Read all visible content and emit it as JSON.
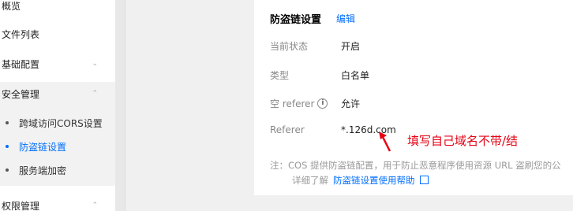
{
  "sidebar": {
    "items": [
      {
        "label": "概览",
        "chevron": ""
      },
      {
        "label": "文件列表",
        "chevron": ""
      },
      {
        "label": "基础配置",
        "chevron": "⌄"
      },
      {
        "label": "安全管理",
        "chevron": "⌃"
      }
    ],
    "security_sub": [
      {
        "label": "跨域访问CORS设置"
      },
      {
        "label": "防盗链设置"
      },
      {
        "label": "服务端加密"
      }
    ],
    "bottom_item": {
      "label": "权限管理",
      "chevron": "⌃"
    }
  },
  "card": {
    "title": "防盗链设置",
    "edit_label": "编辑",
    "rows": [
      {
        "key": "当前状态",
        "value": "开启"
      },
      {
        "key": "类型",
        "value": "白名单"
      },
      {
        "key": "空 referer",
        "value": "允许"
      },
      {
        "key": "Referer",
        "value": "*.126d.com"
      }
    ],
    "note_line1": "注：COS 提供防盗链配置，用于防止恶意程序使用资源 URL 盗刷您的公",
    "note_line2_prefix": "详细了解",
    "note_link": "防盗链设置使用帮助"
  },
  "annotation": {
    "text": "填写自己域名不带/结",
    "color": "#e60012"
  },
  "colors": {
    "accent": "#006eff",
    "annotation": "#e60012"
  },
  "icons": {
    "info": "info-icon",
    "external": "external-link-icon",
    "arrow": "red-arrow-icon"
  }
}
